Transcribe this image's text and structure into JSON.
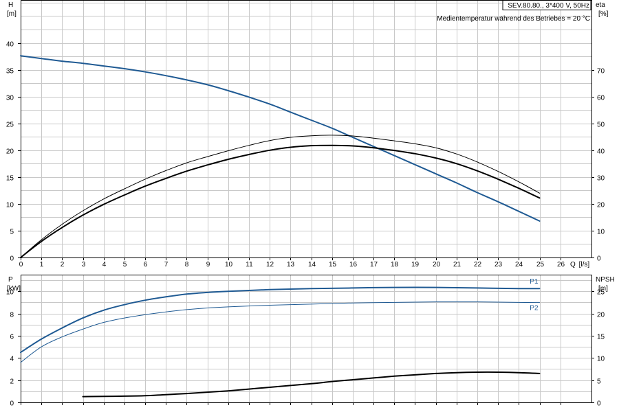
{
  "header": {
    "pump_label": "SEV.80.80., 3*400 V, 50Hz",
    "medium_note": "Medientemperatur während des Betriebes = 20 °C"
  },
  "colors": {
    "blue": "#1f5a93",
    "black": "#000000",
    "grid": "#c8c8c8"
  },
  "chart_data": [
    {
      "type": "line",
      "panel": "top",
      "left_axis": {
        "label": "H",
        "unit": "[m]",
        "lim": [
          0,
          48
        ],
        "ticks": [
          0,
          5,
          10,
          15,
          20,
          25,
          30,
          35,
          40
        ]
      },
      "right_axis": {
        "label": "eta",
        "unit": "[%]",
        "lim": [
          0,
          96
        ],
        "ticks": [
          0,
          10,
          20,
          30,
          40,
          50,
          60,
          70
        ]
      },
      "x_axis": {
        "label": "Q",
        "unit": "[l/s]",
        "lim": [
          0,
          27.5
        ],
        "ticks": [
          0,
          1,
          2,
          3,
          4,
          5,
          6,
          7,
          8,
          9,
          10,
          11,
          12,
          13,
          14,
          15,
          16,
          17,
          18,
          19,
          20,
          21,
          22,
          23,
          24,
          25,
          26
        ]
      },
      "grid": true,
      "series": [
        {
          "axis": "left",
          "color": "blue",
          "width": 2,
          "x": [
            0,
            1,
            2,
            3,
            4,
            5,
            6,
            7,
            8,
            9,
            10,
            11,
            12,
            13,
            14,
            15,
            16,
            17,
            18,
            19,
            20,
            21,
            22,
            23,
            24,
            25
          ],
          "y": [
            37.6,
            37.1,
            36.6,
            36.2,
            35.7,
            35.2,
            34.6,
            33.9,
            33.1,
            32.2,
            31.1,
            29.9,
            28.6,
            27.1,
            25.6,
            24.1,
            22.4,
            20.7,
            19.0,
            17.3,
            15.6,
            13.9,
            12.1,
            10.4,
            8.6,
            6.8
          ]
        },
        {
          "axis": "right",
          "color": "black",
          "width": 1,
          "x": [
            0,
            1,
            2,
            3,
            4,
            5,
            6,
            7,
            8,
            9,
            10,
            11,
            12,
            13,
            14,
            15,
            16,
            17,
            18,
            19,
            20,
            21,
            22,
            23,
            24,
            25
          ],
          "y": [
            0,
            6.6,
            12.4,
            17.4,
            21.8,
            25.6,
            29.2,
            32.4,
            35.3,
            37.6,
            39.8,
            41.8,
            43.6,
            44.8,
            45.4,
            45.6,
            45.3,
            44.5,
            43.5,
            42.4,
            40.9,
            38.6,
            35.6,
            32.1,
            28.2,
            24.0
          ]
        },
        {
          "axis": "right",
          "color": "black",
          "width": 2,
          "x": [
            0,
            1,
            2,
            3,
            4,
            5,
            6,
            7,
            8,
            9,
            10,
            11,
            12,
            13,
            14,
            15,
            16,
            17,
            18,
            19,
            20,
            21,
            22,
            23,
            24,
            25
          ],
          "y": [
            0,
            6.0,
            11.2,
            15.8,
            19.8,
            23.3,
            26.6,
            29.5,
            32.2,
            34.5,
            36.6,
            38.4,
            40.0,
            41.1,
            41.7,
            41.8,
            41.6,
            40.9,
            39.9,
            38.7,
            37.1,
            35.0,
            32.3,
            29.2,
            25.8,
            22.2
          ]
        }
      ]
    },
    {
      "type": "line",
      "panel": "bottom",
      "left_axis": {
        "label": "P",
        "unit": "[kW]",
        "lim": [
          0,
          11.5
        ],
        "ticks": [
          0,
          2,
          4,
          6,
          8,
          10
        ]
      },
      "right_axis": {
        "label": "NPSH",
        "unit": "[m]",
        "lim": [
          0,
          28.75
        ],
        "ticks": [
          0,
          5,
          10,
          15,
          20,
          25
        ]
      },
      "x_axis": {
        "lim": [
          0,
          27.5
        ],
        "ticks": [
          0,
          1,
          2,
          3,
          4,
          5,
          6,
          7,
          8,
          9,
          10,
          11,
          12,
          13,
          14,
          15,
          16,
          17,
          18,
          19,
          20,
          21,
          22,
          23,
          24,
          25,
          26
        ]
      },
      "grid": true,
      "series": [
        {
          "name": "P1",
          "axis": "left",
          "color": "blue",
          "width": 2,
          "x": [
            0,
            1,
            2,
            3,
            4,
            5,
            6,
            7,
            8,
            9,
            10,
            12,
            14,
            16,
            18,
            20,
            22,
            24,
            25
          ],
          "y": [
            4.5,
            5.7,
            6.7,
            7.6,
            8.3,
            8.8,
            9.2,
            9.5,
            9.75,
            9.9,
            10.0,
            10.15,
            10.25,
            10.3,
            10.35,
            10.35,
            10.3,
            10.25,
            10.25
          ]
        },
        {
          "name": "P2",
          "axis": "left",
          "color": "blue",
          "width": 1,
          "x": [
            0,
            1,
            2,
            3,
            4,
            5,
            6,
            7,
            8,
            9,
            10,
            12,
            14,
            16,
            18,
            20,
            22,
            24,
            25
          ],
          "y": [
            3.6,
            5.0,
            5.9,
            6.6,
            7.2,
            7.6,
            7.9,
            8.15,
            8.35,
            8.5,
            8.6,
            8.75,
            8.85,
            8.95,
            9.0,
            9.05,
            9.05,
            9.0,
            9.0
          ]
        },
        {
          "axis": "right",
          "color": "black",
          "width": 2,
          "x": [
            3,
            4,
            5,
            6,
            7,
            8,
            9,
            10,
            11,
            12,
            13,
            14,
            15,
            16,
            17,
            18,
            19,
            20,
            21,
            22,
            23,
            24,
            25
          ],
          "y": [
            1.3,
            1.35,
            1.4,
            1.5,
            1.75,
            2.0,
            2.3,
            2.6,
            3.0,
            3.4,
            3.8,
            4.2,
            4.7,
            5.1,
            5.5,
            5.9,
            6.2,
            6.5,
            6.7,
            6.8,
            6.8,
            6.7,
            6.5
          ]
        }
      ]
    }
  ]
}
